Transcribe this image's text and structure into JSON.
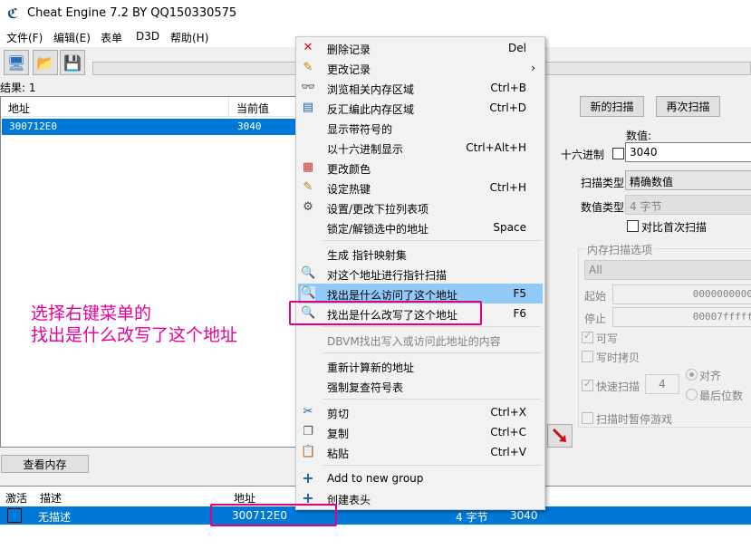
{
  "window": {
    "title": "Cheat Engine 7.2 BY QQ150330575"
  },
  "menu": [
    "文件(F)",
    "编辑(E)",
    "表单",
    "D3D",
    "帮助(H)"
  ],
  "results": {
    "count_label": "结果: 1",
    "headers": [
      "地址",
      "当前值"
    ],
    "rows": [
      {
        "address": "300712E0",
        "value": "3040"
      }
    ]
  },
  "buttons": {
    "new_scan": "新的扫描",
    "next_scan": "再次扫描",
    "view_memory": "查看内存"
  },
  "scan": {
    "value_label": "数值:",
    "hex_label": "十六进制",
    "value": "3040",
    "scan_type_label": "扫描类型",
    "scan_type": "精确数值",
    "value_type_label": "数值类型",
    "value_type": "4 字节",
    "compare_first_label": "对比首次扫描"
  },
  "memory_options": {
    "title": "内存扫描选项",
    "region": "All",
    "start_label": "起始",
    "start_value": "0000000000",
    "stop_label": "停止",
    "stop_value": "00007fffff",
    "writable_label": "可写",
    "copy_on_write_label": "写时拷贝",
    "fast_scan_label": "快速扫描",
    "fast_scan_value": "4",
    "align_label": "对齐",
    "last_digits_label": "最后位数",
    "pause_label": "扫描时暂停游戏"
  },
  "address_list": {
    "headers": [
      "激活",
      "描述",
      "地址"
    ],
    "row": {
      "description": "无描述",
      "address": "300712E0",
      "type": "4 字节",
      "value": "3040"
    }
  },
  "context_menu": {
    "items": [
      {
        "label": "删除记录",
        "shortcut": "Del",
        "icon": "delete-icon",
        "glyph": "✕"
      },
      {
        "label": "更改记录",
        "shortcut": "›",
        "icon": "edit-record-icon",
        "glyph": "✎"
      },
      {
        "label": "浏览相关内存区域",
        "shortcut": "Ctrl+B",
        "icon": "binoculars-icon",
        "glyph": "👓"
      },
      {
        "label": "反汇编此内存区域",
        "shortcut": "Ctrl+D",
        "icon": "disassemble-icon",
        "glyph": "▤"
      },
      {
        "label": "显示带符号的",
        "shortcut": "",
        "icon": "",
        "glyph": ""
      },
      {
        "label": "以十六进制显示",
        "shortcut": "Ctrl+Alt+H",
        "icon": "",
        "glyph": ""
      },
      {
        "label": "更改颜色",
        "shortcut": "",
        "icon": "color-icon",
        "glyph": "▦"
      },
      {
        "label": "设定热键",
        "shortcut": "Ctrl+H",
        "icon": "hotkey-icon",
        "glyph": "✎"
      },
      {
        "label": "设置/更改下拉列表项",
        "shortcut": "",
        "icon": "gear-icon",
        "glyph": "⚙"
      },
      {
        "label": "锁定/解锁选中的地址",
        "shortcut": "Space",
        "icon": "",
        "glyph": ""
      },
      {
        "label": "生成 指针映射集",
        "shortcut": "",
        "icon": "",
        "glyph": ""
      },
      {
        "label": "对这个地址进行指针扫描",
        "shortcut": "",
        "icon": "pointer-scan-icon",
        "glyph": "🔍"
      },
      {
        "label": "找出是什么访问了这个地址",
        "shortcut": "F5",
        "icon": "find-access-icon",
        "glyph": "🔍"
      },
      {
        "label": "找出是什么改写了这个地址",
        "shortcut": "F6",
        "icon": "find-write-icon",
        "glyph": "🔍"
      },
      {
        "label": "DBVM找出写入或访问此地址的内容",
        "shortcut": "",
        "icon": "",
        "glyph": ""
      },
      {
        "label": "重新计算新的地址",
        "shortcut": "",
        "icon": "",
        "glyph": ""
      },
      {
        "label": "强制复查符号表",
        "shortcut": "",
        "icon": "",
        "glyph": ""
      },
      {
        "label": "剪切",
        "shortcut": "Ctrl+X",
        "icon": "scissors-icon",
        "glyph": "✂"
      },
      {
        "label": "复制",
        "shortcut": "Ctrl+C",
        "icon": "copy-icon",
        "glyph": "❐"
      },
      {
        "label": "粘贴",
        "shortcut": "Ctrl+V",
        "icon": "paste-icon",
        "glyph": "📋"
      },
      {
        "label": "Add to new group",
        "shortcut": "",
        "icon": "add-group-icon",
        "glyph": "+"
      },
      {
        "label": "创建表头",
        "shortcut": "",
        "icon": "create-header-icon",
        "glyph": "+"
      }
    ]
  },
  "annotation": {
    "line1": "选择右键菜单的",
    "line2": "找出是什么改写了这个地址"
  },
  "colors": {
    "selection": "#0078d7",
    "highlight": "#91c9f7",
    "annotation": "#e4007f"
  }
}
